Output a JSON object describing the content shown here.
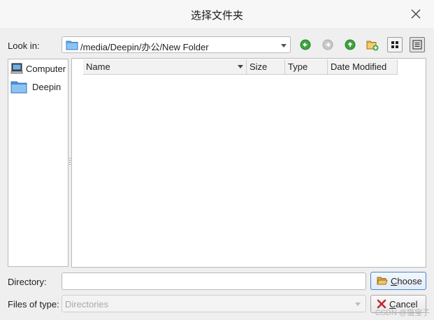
{
  "window": {
    "title": "选择文件夹"
  },
  "toolbar": {
    "look_in_label": "Look in:",
    "current_path": "/media/Deepin/办公/New Folder"
  },
  "sidebar": {
    "items": [
      {
        "label": "Computer",
        "icon": "computer-icon"
      },
      {
        "label": "Deepin",
        "icon": "folder-icon"
      }
    ]
  },
  "file_list": {
    "columns": [
      "Name",
      "Size",
      "Type",
      "Date Modified"
    ],
    "rows": []
  },
  "directory": {
    "label": "Directory:",
    "value": ""
  },
  "files_of_type": {
    "label": "Files of type:",
    "value": "Directories"
  },
  "buttons": {
    "choose": {
      "pre": "",
      "accel": "C",
      "post": "hoose"
    },
    "cancel": {
      "pre": "",
      "accel": "C",
      "post": "ancel"
    }
  },
  "watermark": "CSDN @猫宝子",
  "colors": {
    "accent": "#4a86c8",
    "back_green": "#3ea33e",
    "folder": "#5ea5e8"
  }
}
